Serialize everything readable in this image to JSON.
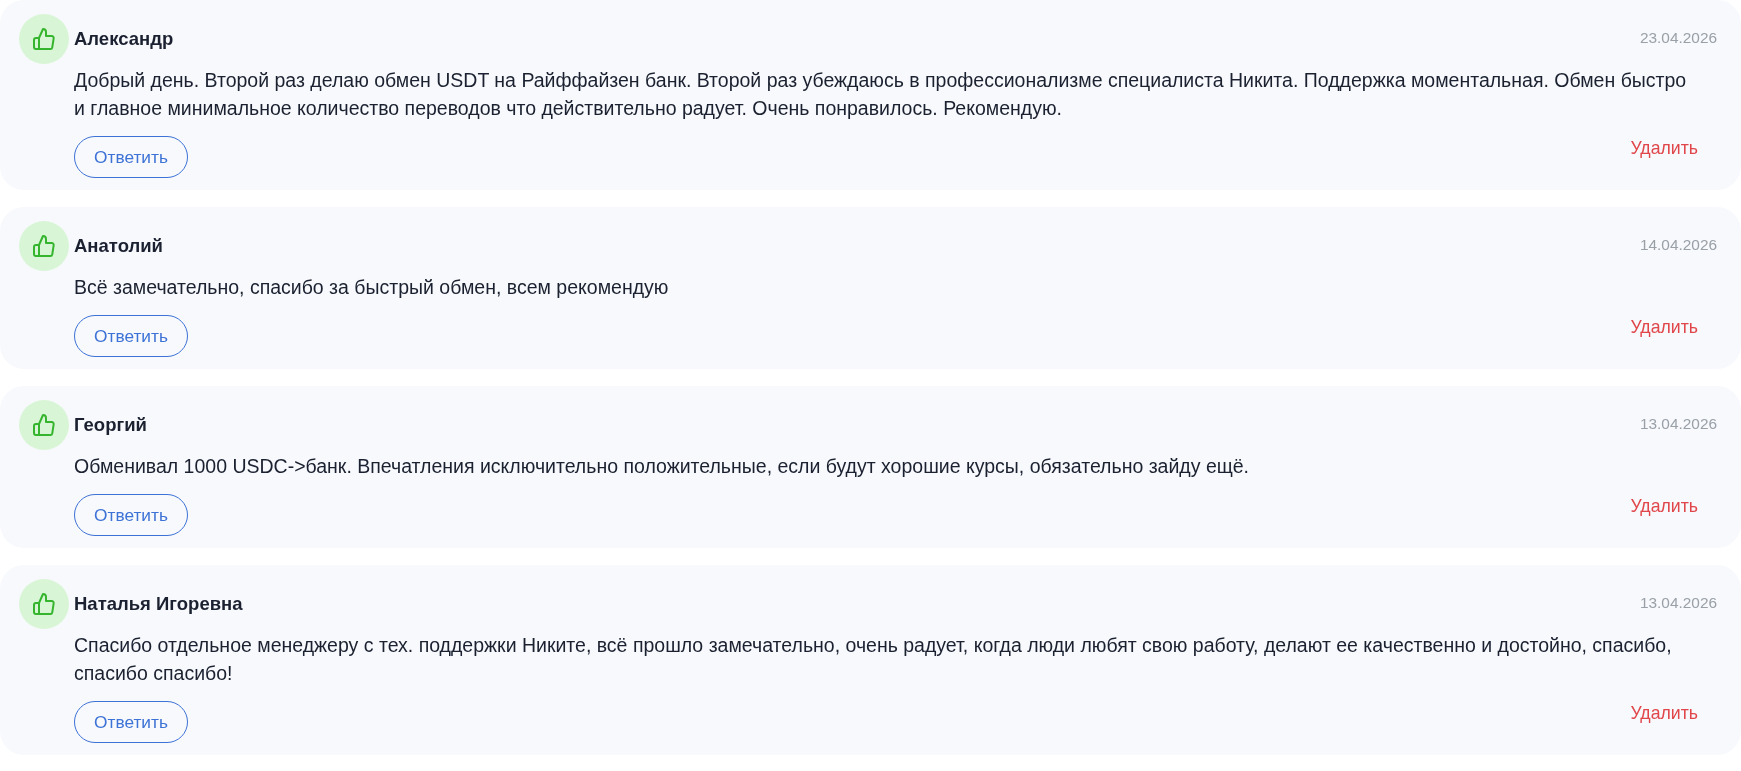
{
  "reviews": [
    {
      "author": "Александр",
      "date": "23.04.2026",
      "text": "Добрый день. Второй раз делаю обмен USDT на Райффайзен банк. Второй раз убеждаюсь в профессионализме специалиста Никита. Поддержка моментальная. Обмен быстро и главное минимальное количество переводов что действительно радует. Очень понравилось. Рекомендую.",
      "reply_button": "Ответить",
      "delete_link": "Удалить"
    },
    {
      "author": "Анатолий",
      "date": "14.04.2026",
      "text": "Всё замечательно, спасибо за быстрый обмен, всем рекомендую",
      "reply_button": "Ответить",
      "delete_link": "Удалить"
    },
    {
      "author": "Георгий",
      "date": "13.04.2026",
      "text": "Обменивал 1000 USDC->банк. Впечатления исключительно положительные, если будут хорошие курсы, обязательно зайду ещё.",
      "reply_button": "Ответить",
      "delete_link": "Удалить"
    },
    {
      "author": "Наталья Игоревна",
      "date": "13.04.2026",
      "text": "Спасибо отдельное менеджеру с тех. поддержки Никите, всё прошло замечательно, очень радует, когда люди любят свою работу, делают ее качественно и достойно, спасибо, спасибо спасибо!",
      "reply_button": "Ответить",
      "delete_link": "Удалить"
    }
  ]
}
